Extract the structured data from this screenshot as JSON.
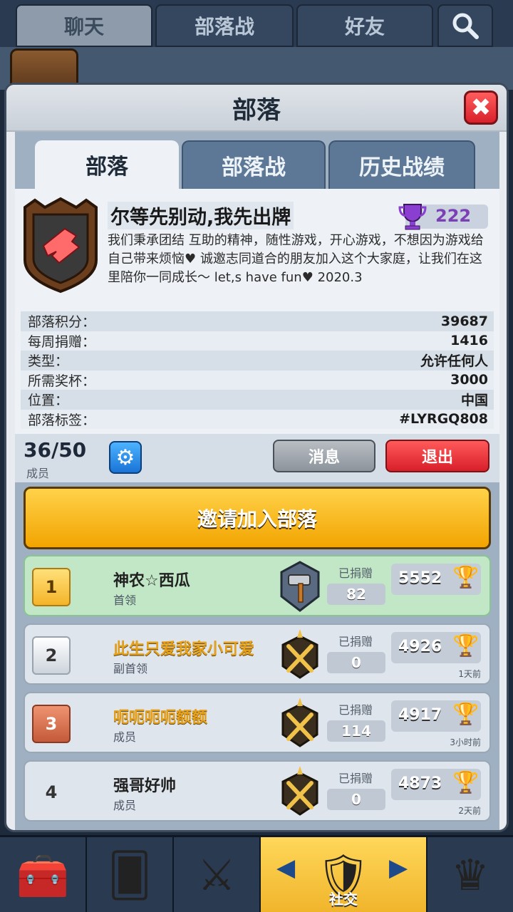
{
  "top_tabs": [
    "聊天",
    "部落战",
    "好友"
  ],
  "panel": {
    "title": "部落",
    "close_label": "✖"
  },
  "sub_tabs": [
    "部落",
    "部落战",
    "历史战绩"
  ],
  "clan": {
    "name": "尔等先别动,我先出牌",
    "trophies": "222",
    "description": "我们秉承团结 互助的精神，随性游戏，开心游戏，不想因为游戏给自己带来烦恼♥ 诚邀志同道合的朋友加入这个大家庭，让我们在这里陪你一同成长～ let,s have fun♥ 2020.3"
  },
  "stats": [
    {
      "label": "部落积分：",
      "value": "39687"
    },
    {
      "label": "每周捐赠：",
      "value": "1416"
    },
    {
      "label": "类型：",
      "value": "允许任何人"
    },
    {
      "label": "所需奖杯：",
      "value": "3000"
    },
    {
      "label": "位置：",
      "value": "中国"
    },
    {
      "label": "部落标签：",
      "value": "#LYRGQ808"
    }
  ],
  "members_bar": {
    "count": "36/50",
    "label": "成员",
    "message_button": "消息",
    "leave_button": "退出"
  },
  "invite_button": "邀请加入部落",
  "donated_label": "已捐赠",
  "members": [
    {
      "rank": "1",
      "name": "神农☆西瓜",
      "role": "首领",
      "donated": "82",
      "trophies": "5552",
      "last_seen": ""
    },
    {
      "rank": "2",
      "name": "此生只爱我家小可爱",
      "role": "副首领",
      "donated": "0",
      "trophies": "4926",
      "last_seen": "1天前"
    },
    {
      "rank": "3",
      "name": "呃呃呃呃额额",
      "role": "成员",
      "donated": "114",
      "trophies": "4917",
      "last_seen": "3小时前"
    },
    {
      "rank": "4",
      "name": "强哥好帅",
      "role": "成员",
      "donated": "0",
      "trophies": "4873",
      "last_seen": "2天前"
    }
  ],
  "bottom_nav": {
    "active_label": "社交"
  },
  "colors": {
    "accent_gold": "#f2a400",
    "danger_red": "#d81f2a",
    "info_blue": "#1a74d6",
    "leader_green": "#c2e7c6"
  }
}
